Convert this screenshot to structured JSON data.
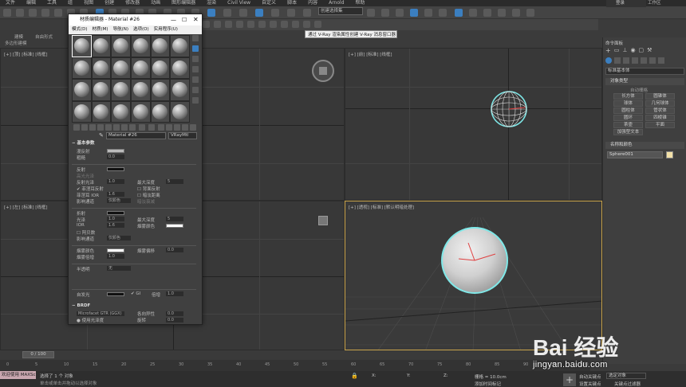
{
  "menubar": {
    "items": [
      "文件",
      "编辑",
      "工具",
      "组",
      "视图",
      "创建",
      "修改器",
      "动画",
      "图形编辑器",
      "渲染",
      "Civil View",
      "自定义",
      "脚本",
      "内容",
      "Arnold",
      "帮助"
    ]
  },
  "toolbar": {
    "selection_set_placeholder": "创建选择集",
    "tooltip": "通过 V-Ray 渲染属性创建 V-Ray 消息窗口器",
    "signin": "登录",
    "workspace": "工作区"
  },
  "leftpanel": {
    "tab1": "建模",
    "tab2": "自由形式",
    "tab3": "多边形建模"
  },
  "viewports": {
    "top_left_label": "[+] [顶] [标准] [线框]",
    "top_right_label": "[+] [前] [标准] [线框]",
    "bottom_left_label": "[+] [左] [标准] [线框]",
    "bottom_right_label": "[+] [透视] [标准] [默认明暗处理]"
  },
  "material_editor": {
    "title": "材质编辑器 - Material #26",
    "menu": [
      "模式(D)",
      "材质(M)",
      "导航(N)",
      "选项(O)",
      "实用程序(U)"
    ],
    "material_name": "Material #26",
    "material_type": "VRayMtl",
    "basic_params_title": "基本参数",
    "diffuse_label": "漫反射",
    "roughness_label": "粗糙",
    "reflection_label": "反射",
    "hilight_gloss_label": "高光光泽",
    "refl_gloss_label": "反射光泽",
    "fresnel_label": "菲涅耳反射",
    "fresnel_ior_label": "菲涅耳 IOR",
    "max_depth_label": "最大深度",
    "back_reflect_label": "背面反射",
    "dim_distance_label": "暗淡距离",
    "dim_falloff_label": "暗淡衰减",
    "affect_channels_label": "影响通道",
    "affect_channels_value": "仅颜色",
    "refraction_label": "折射",
    "glossiness_label": "光泽",
    "ior_label": "IOR",
    "abbe_label": "阿贝数",
    "fog_color_label": "烟雾颜色",
    "fog_multiplier_label": "烟雾倍增",
    "fog_bias_label": "烟雾偏移",
    "translucency_label": "半透明",
    "translucency_value": "无",
    "self_illum_label": "自发光",
    "gi_label": "GI",
    "multiplier_label": "倍增",
    "brdf_title": "BRDF",
    "brdf_type": "Microfacet GTR (GGX)",
    "anisotropy_label": "各向异性",
    "rotation_label": "旋转",
    "use_gloss_label": "使用光泽度",
    "values": {
      "diffuse_roughness": "0.0",
      "refl_max_depth": "5",
      "refl_gloss": "1.0",
      "fresnel_ior": "1.6",
      "refr_gloss": "1.0",
      "refr_ior": "1.6",
      "refr_max_depth": "5",
      "fog_multiplier": "1.0",
      "fog_bias": "0.0",
      "self_illum_mult": "1.0",
      "anisotropy": "0.0",
      "rotation": "0.0"
    }
  },
  "command_panel": {
    "title": "命令面板",
    "category": "标准基本体",
    "object_type_title": "对象类型",
    "autogrid_label": "自动栅格",
    "buttons": [
      "长方体",
      "圆锥体",
      "球体",
      "几何球体",
      "圆柱体",
      "管状体",
      "圆环",
      "四棱锥",
      "茶壶",
      "平面",
      "加强型文本"
    ],
    "name_color_title": "名称和颜色",
    "object_name": "Sphere001"
  },
  "timeline": {
    "frame": "0 / 100",
    "ticks": [
      "0",
      "5",
      "10",
      "15",
      "20",
      "25",
      "30",
      "35",
      "40",
      "45",
      "50",
      "55",
      "60",
      "65",
      "70",
      "75",
      "80",
      "85",
      "90",
      "95",
      "100"
    ]
  },
  "status": {
    "welcome": "欢迎使用 MAXSc",
    "selected": "选择了 1 个 对象",
    "hint": "单击或单击并拖动以选择对象",
    "x_label": "X:",
    "y_label": "Y:",
    "z_label": "Z:",
    "grid": "栅格 = 10.0cm",
    "add_time_tag": "添加时间标记",
    "auto_key": "自动关键点",
    "set_key": "设置关键点",
    "selected_object": "选定对象",
    "key_filters": "关键点过滤器"
  },
  "watermark": {
    "logo": "Bai 经验",
    "url": "jingyan.baidu.com"
  }
}
